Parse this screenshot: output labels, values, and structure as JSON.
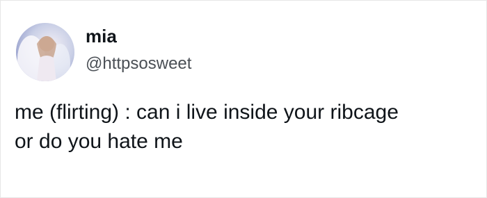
{
  "user": {
    "display_name": "mia",
    "handle": "@httpsosweet",
    "avatar_icon": "profile-picture-angel-icon"
  },
  "tweet": {
    "lines": [
      "me (flirting) : can i live inside your ribcage",
      "or do you hate me"
    ]
  },
  "colors": {
    "background": "#ffffff",
    "text": "#0f1419",
    "handle": "#4a4f55"
  }
}
